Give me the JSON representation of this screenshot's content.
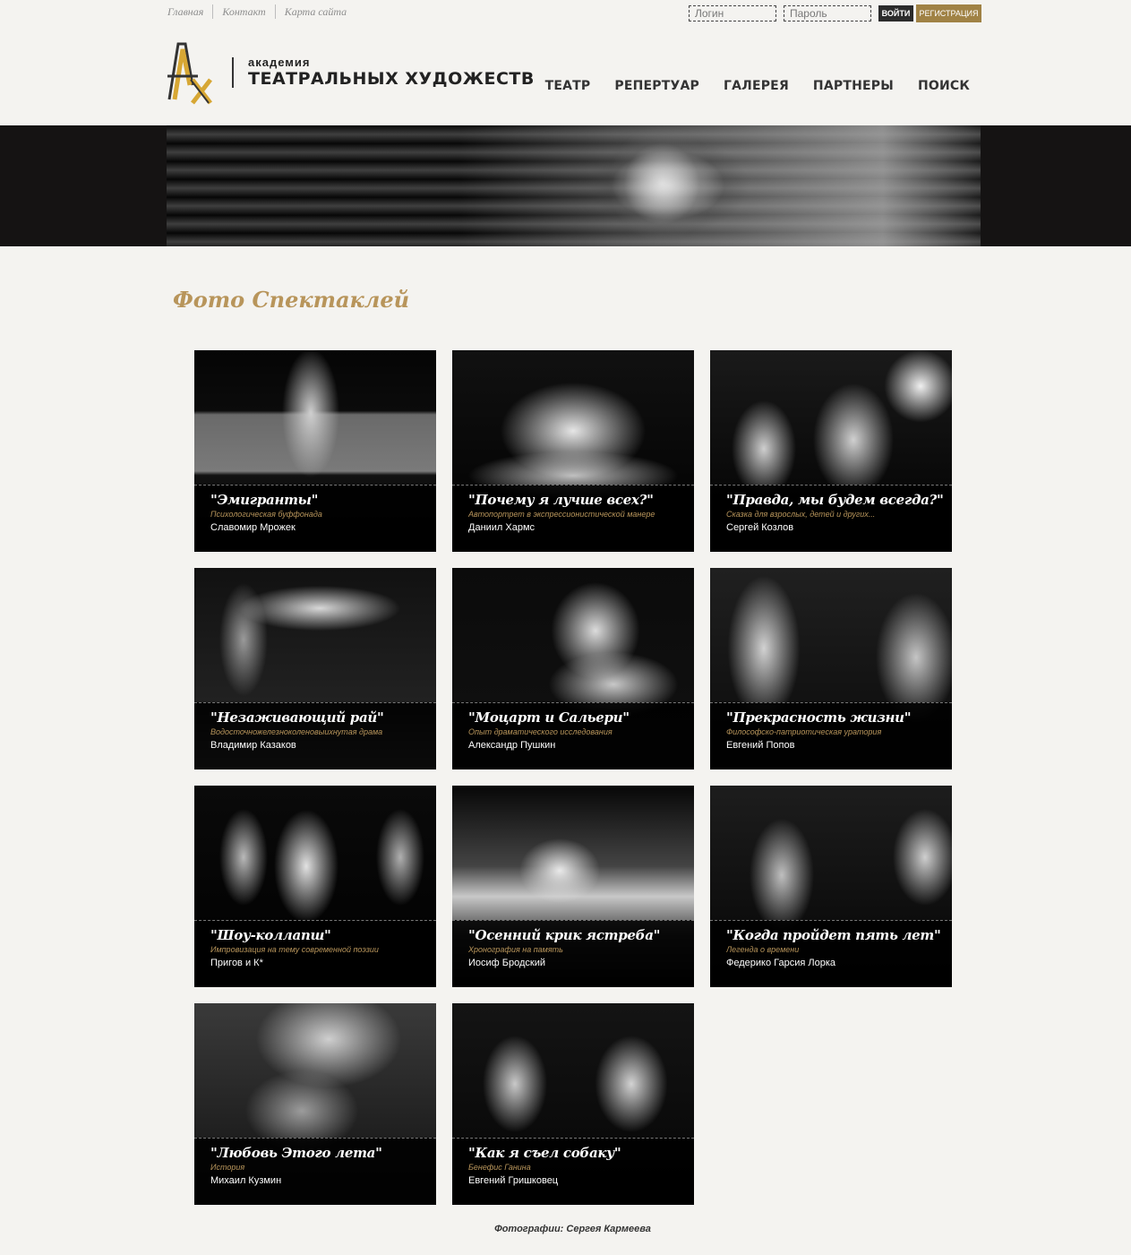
{
  "top_links": [
    "Главная",
    "Контакт",
    "Карта сайта"
  ],
  "login": {
    "login_placeholder": "Логин",
    "password_placeholder": "Пароль",
    "enter_label": "ВОЙТИ",
    "register_label": "РЕГИСТРАЦИЯ"
  },
  "logo": {
    "small": "академия",
    "big": "ТЕАТРАЛЬНЫХ ХУДОЖЕСТВ"
  },
  "nav": [
    "ТЕАТР",
    "РЕПЕРТУАР",
    "ГАЛЕРЕЯ",
    "ПАРТНЕРЫ",
    "ПОИСК"
  ],
  "page_title": "Фото Спектаклей",
  "cards": [
    {
      "title": "\"Эмигранты\"",
      "subtitle": "Психологическая буффонада",
      "author": "Славомир Мрожек"
    },
    {
      "title": "\"Почему я лучше всех?\"",
      "subtitle": "Автопортрет в экспрессионистической манере",
      "author": "Даниил Хармс"
    },
    {
      "title": "\"Правда, мы будем всегда?\"",
      "subtitle": "Сказка для взрослых, детей и других...",
      "author": "Сергей Козлов"
    },
    {
      "title": "\"Незаживающий рай\"",
      "subtitle": "Водосточножелезноколеновыихнутая драма",
      "author": "Владимир Казаков"
    },
    {
      "title": "\"Моцарт и Сальери\"",
      "subtitle": "Опыт драматического исследования",
      "author": "Александр Пушкин"
    },
    {
      "title": "\"Прекрасность жизни\"",
      "subtitle": "Философско-патриотическая уратория",
      "author": "Евгений Попов"
    },
    {
      "title": "\"Шоу-коллапш\"",
      "subtitle": "Импровизация на тему современной поэзии",
      "author": "Пригов и К*"
    },
    {
      "title": "\"Осенний крик ястреба\"",
      "subtitle": "Хронография на память",
      "author": "Иосиф Бродский"
    },
    {
      "title": "\"Когда пройдет пять лет\"",
      "subtitle": "Легенда о времени",
      "author": "Федерико Гарсия Лорка"
    },
    {
      "title": "\"Любовь Этого лета\"",
      "subtitle": "История",
      "author": "Михаил Кузмин"
    },
    {
      "title": "\"Как я съел собаку\"",
      "subtitle": "Бенефис Ганина",
      "author": "Евгений Гришковец"
    }
  ],
  "credit": "Фотографии: Сергея Кармеева",
  "colors": {
    "accent": "#b8955b",
    "register": "#a08245",
    "background": "#f4f3f0"
  }
}
